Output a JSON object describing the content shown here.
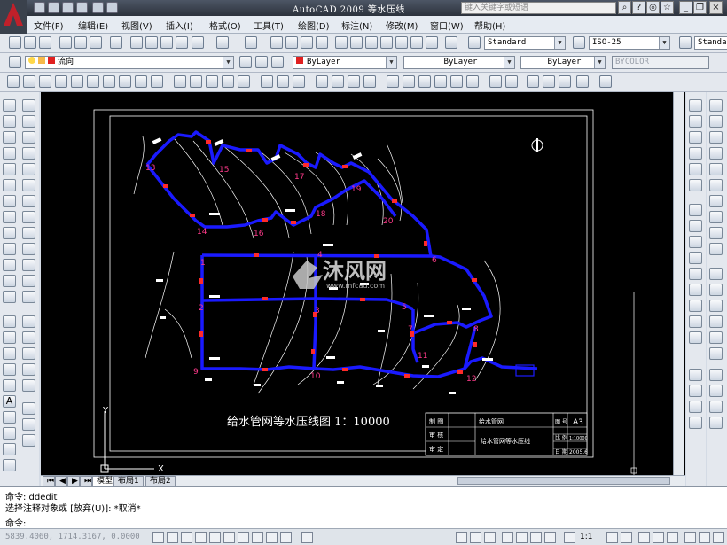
{
  "window": {
    "app_name": "AutoCAD 2009",
    "doc_title": "等水压线",
    "search_placeholder": "键入关键字或短语",
    "close_symbol": "×"
  },
  "menu": [
    "文件(F)",
    "编辑(E)",
    "视图(V)",
    "插入(I)",
    "格式(O)",
    "工具(T)",
    "绘图(D)",
    "标注(N)",
    "修改(M)",
    "窗口(W)",
    "帮助(H)"
  ],
  "toolbar": {
    "text_style": "Standard",
    "dim_style": "ISO-25",
    "table_style": "Standar",
    "layer": "流向",
    "color": "ByLayer",
    "linetype": "ByLayer",
    "lineweight": "ByLayer",
    "plot_style": "BYCOLOR"
  },
  "drawing": {
    "title": "给水管网等水压线图  1：10000",
    "node_labels": [
      "13",
      "14",
      "15",
      "16",
      "17",
      "18",
      "19",
      "20",
      "1",
      "2",
      "3",
      "4",
      "5",
      "6",
      "7",
      "8",
      "9",
      "10",
      "11",
      "12"
    ],
    "title_block": {
      "r1c1": "制 图",
      "r1c2": "给水管网",
      "r2c1": "审 核",
      "r2c2": "给水管网等水压线",
      "r3c1": "审 定",
      "size_lbl": "图 号",
      "size_val": "A3",
      "scale_lbl": "比 例",
      "scale_val": "1:10000",
      "date_lbl": "日 期",
      "date_val": "2005.6"
    },
    "axis_x": "X",
    "axis_y": "Y"
  },
  "watermark": {
    "brand": "沐风网",
    "url": "www.mfcad.com"
  },
  "layout_tabs": [
    "模型",
    "布局1",
    "布局2"
  ],
  "command": {
    "line1": "命令:   ddedit",
    "line2": "选择注释对象或 [放弃(U)]: *取消*",
    "prompt": "命令:"
  },
  "status": {
    "coords": "5839.4060, 1714.3167, 0.0000",
    "scale": "1:1"
  },
  "colors": {
    "pipe": "#1a1aff",
    "node": "#ff2a2a",
    "label": "#ff2a8a",
    "canvas": "#000000"
  }
}
